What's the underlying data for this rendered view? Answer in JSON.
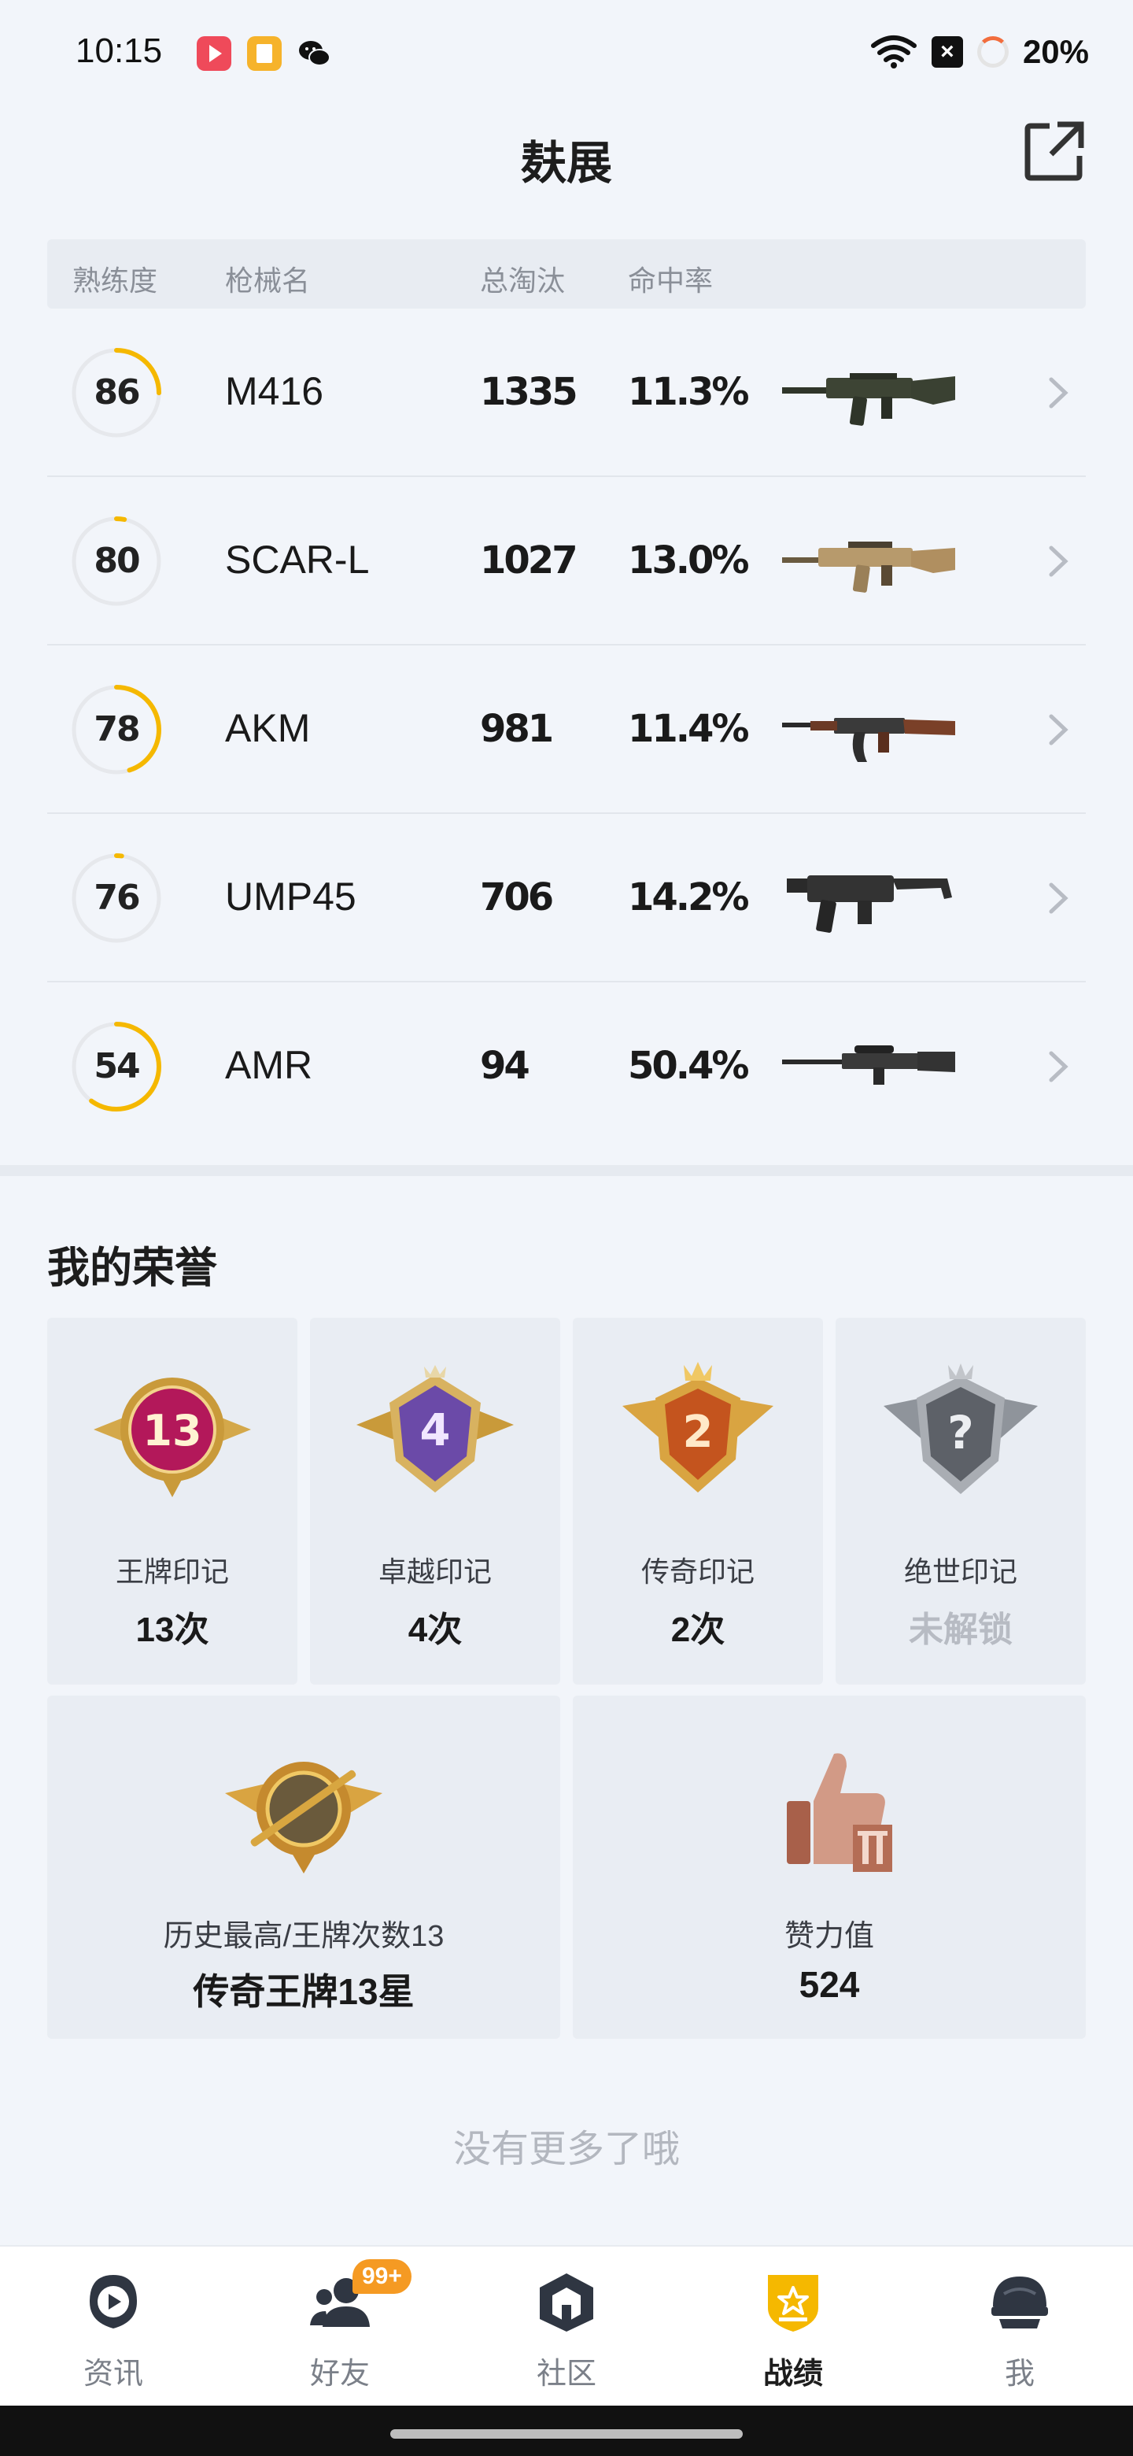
{
  "status_bar": {
    "time": "10:15",
    "battery": "20%"
  },
  "header": {
    "title": "麸展"
  },
  "table": {
    "headers": {
      "mastery": "熟练度",
      "gun_name": "枪械名",
      "kills": "总淘汰",
      "accuracy": "命中率"
    },
    "rows": [
      {
        "mastery": "86",
        "mastery_level": 0.25,
        "name": "M416",
        "kills": "1335",
        "accuracy": "11.3%",
        "gun_icon": "m416-rifle-icon"
      },
      {
        "mastery": "80",
        "mastery_level": 0.03,
        "name": "SCAR-L",
        "kills": "1027",
        "accuracy": "13.0%",
        "gun_icon": "scar-l-rifle-icon"
      },
      {
        "mastery": "78",
        "mastery_level": 0.45,
        "name": "AKM",
        "kills": "981",
        "accuracy": "11.4%",
        "gun_icon": "akm-rifle-icon"
      },
      {
        "mastery": "76",
        "mastery_level": 0.02,
        "name": "UMP45",
        "kills": "706",
        "accuracy": "14.2%",
        "gun_icon": "ump45-smg-icon"
      },
      {
        "mastery": "54",
        "mastery_level": 0.6,
        "name": "AMR",
        "kills": "94",
        "accuracy": "50.4%",
        "gun_icon": "amr-sniper-icon"
      }
    ]
  },
  "honors": {
    "title": "我的荣誉",
    "medals": [
      {
        "name": "王牌印记",
        "count": "13次",
        "badge_number": "13",
        "icon": "ace-mark-medal-icon"
      },
      {
        "name": "卓越印记",
        "count": "4次",
        "badge_number": "4",
        "icon": "excellence-mark-medal-icon"
      },
      {
        "name": "传奇印记",
        "count": "2次",
        "badge_number": "2",
        "icon": "legend-mark-medal-icon"
      },
      {
        "name": "绝世印记",
        "count": "未解锁",
        "badge_number": "?",
        "icon": "peerless-mark-medal-icon",
        "locked": true
      }
    ],
    "stats": [
      {
        "label": "历史最高/王牌次数13",
        "value": "传奇王牌13星",
        "icon": "highest-rank-medal-icon"
      },
      {
        "label": "赞力值",
        "value": "524",
        "icon": "thumbs-up-icon"
      }
    ]
  },
  "footer": {
    "no_more": "没有更多了哦"
  },
  "bottom_nav": {
    "items": [
      {
        "label": "资讯",
        "icon": "news-play-icon"
      },
      {
        "label": "好友",
        "icon": "friends-icon",
        "badge": "99+"
      },
      {
        "label": "社区",
        "icon": "community-icon"
      },
      {
        "label": "战绩",
        "icon": "record-shield-icon",
        "active": true
      },
      {
        "label": "我",
        "icon": "profile-helmet-icon"
      }
    ]
  },
  "colors": {
    "accent": "#f5b800",
    "background": "#f2f5fa",
    "card": "#e9edf3",
    "badge": "#f59a23"
  }
}
